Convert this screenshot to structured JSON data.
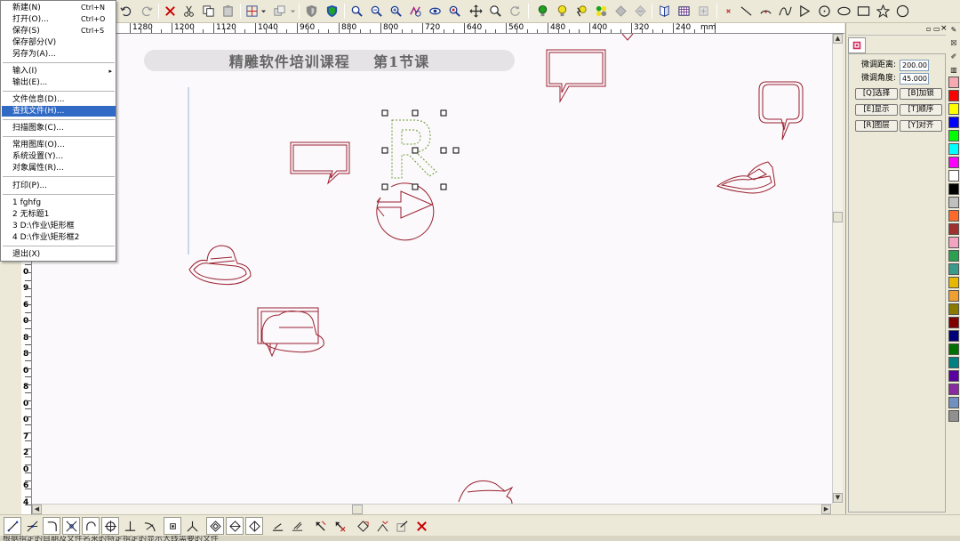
{
  "canvas": {
    "banner_text": "精雕软件培训课程    第1节课"
  },
  "file_menu": {
    "items": [
      {
        "label": "新建(N)",
        "shortcut": "Ctrl+N"
      },
      {
        "label": "打开(O)...",
        "shortcut": "Ctrl+O"
      },
      {
        "label": "保存(S)",
        "shortcut": "Ctrl+S"
      },
      {
        "label": "保存部分(V)",
        "shortcut": ""
      },
      {
        "label": "另存为(A)...",
        "shortcut": ""
      },
      {
        "label": "输入(I)",
        "shortcut": ""
      },
      {
        "label": "输出(E)...",
        "shortcut": ""
      },
      {
        "label": "文件信息(D)...",
        "shortcut": ""
      },
      {
        "label": "查找文件(H)...",
        "shortcut": ""
      },
      {
        "label": "扫描图象(C)...",
        "shortcut": ""
      },
      {
        "label": "常用图库(O)...",
        "shortcut": ""
      },
      {
        "label": "系统设置(Y)...",
        "shortcut": ""
      },
      {
        "label": "对象属性(R)...",
        "shortcut": ""
      },
      {
        "label": "打印(P)...",
        "shortcut": ""
      },
      {
        "label": "1 fghfg",
        "shortcut": ""
      },
      {
        "label": "2 无标题1",
        "shortcut": ""
      },
      {
        "label": "3 D:\\作业\\矩形框",
        "shortcut": ""
      },
      {
        "label": "4 D:\\作业\\矩形框2",
        "shortcut": ""
      },
      {
        "label": "退出(X)",
        "shortcut": ""
      }
    ],
    "submenu_arrow": "▸"
  },
  "ruler": {
    "horizontal_labels": [
      "1280",
      "1200",
      "1120",
      "1040",
      "960",
      "880",
      "800",
      "720",
      "640",
      "560",
      "480",
      "400",
      "320",
      "240",
      "mm"
    ],
    "vertical_labels": [
      "4",
      "0",
      "9",
      "6",
      "0",
      "8",
      "8",
      "0",
      "8",
      "0",
      "0",
      "7",
      "2",
      "0",
      "6",
      "4"
    ]
  },
  "right_panel": {
    "header_buttons": [
      "▫",
      "▭",
      "×"
    ],
    "distance_label": "微调距离:",
    "distance_value": "200.00",
    "angle_label": "微调角度:",
    "angle_value": "45.000",
    "buttons": [
      "[Q]选择",
      "[B]加锁",
      "[E]显示",
      "[T]顺序",
      "[R]图层",
      "[Y]对齐"
    ]
  },
  "palette_colors": [
    "#f7a8b0",
    "#ff0000",
    "#ffff00",
    "#0000ff",
    "#00ff00",
    "#00ffff",
    "#ff00ff",
    "#ffffff",
    "#000000",
    "#c0c0c0",
    "#ff6a2a",
    "#a03030",
    "#f4a4c0",
    "#2aa050",
    "#3a9b8a",
    "#e8b800",
    "#f0a030",
    "#8a7a00",
    "#800000",
    "#00007a",
    "#007000",
    "#008080",
    "#5a00a0",
    "#8a2aa0",
    "#7090c0",
    "#909090"
  ],
  "status_text": "根据指定的目期及文件名来的特定指定的显示大线需要的文件",
  "colors": {
    "menu_highlight": "#316ac5",
    "drawing_stroke": "#9a2030",
    "selection_green": "#6a9a30"
  }
}
